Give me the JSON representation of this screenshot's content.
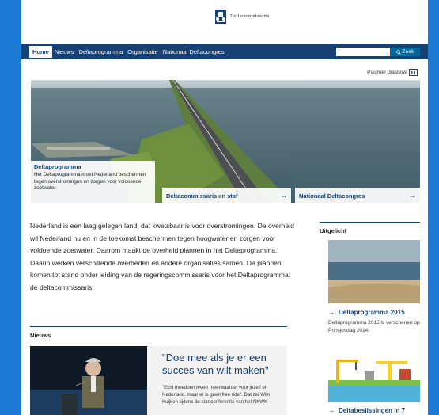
{
  "header": {
    "logo_text": "Deltacommissaris"
  },
  "nav": {
    "items": [
      "Home",
      "Nieuws",
      "Deltaprogramma",
      "Organisatie",
      "Nationaal Deltacongres"
    ],
    "search_placeholder": "",
    "search_label": "Zoek"
  },
  "slideshow": {
    "pause_label": "Pauzeer diashow",
    "main_title": "Deltaprogramma",
    "main_text": "Het Deltaprogramma moet Nederland beschermen tegen overstromingen en zorgen voor voldoende zoetwater.",
    "tab_staff": "Deltacommissaris en staf",
    "tab_congres": "Nationaal Deltacongres",
    "arrow": "→"
  },
  "intro": "Nederland is een laag gelegen land, dat kwetsbaar is voor overstromingen. De overheid wil Nederland nu en in de toekomst beschermen tegen hoogwater en zorgen voor voldoende zoetwater. Daarom maakt de overheid plannen in het Deltaprogramma. Daarin werken verschillende overheden en andere organisaties samen. De plannen komen tot stand onder leiding van de regeringscommissaris voor het Deltaprogramma: de deltacommissaris.",
  "news": {
    "heading": "Nieuws",
    "quote": "\"Doe mee als je er een succes van wilt maken\"",
    "body": "\"Echt meedoen levert meerwaarde, voor jezelf en Nederland, maar er is geen free ride\". Dat zei Wim Kuijken tijdens de startconferentie van het NKWK"
  },
  "sidebar": {
    "heading": "Uitgelicht",
    "item1_title": "Deltaprogramma 2015",
    "item1_desc": "Deltaprogramma 2015 is verschenen op Prinsjesdag 2014.",
    "item2_title": "Deltabeslissingen in 7",
    "arrow": "→"
  },
  "colors": {
    "brand": "#154273",
    "frame": "#1b7ad3"
  }
}
